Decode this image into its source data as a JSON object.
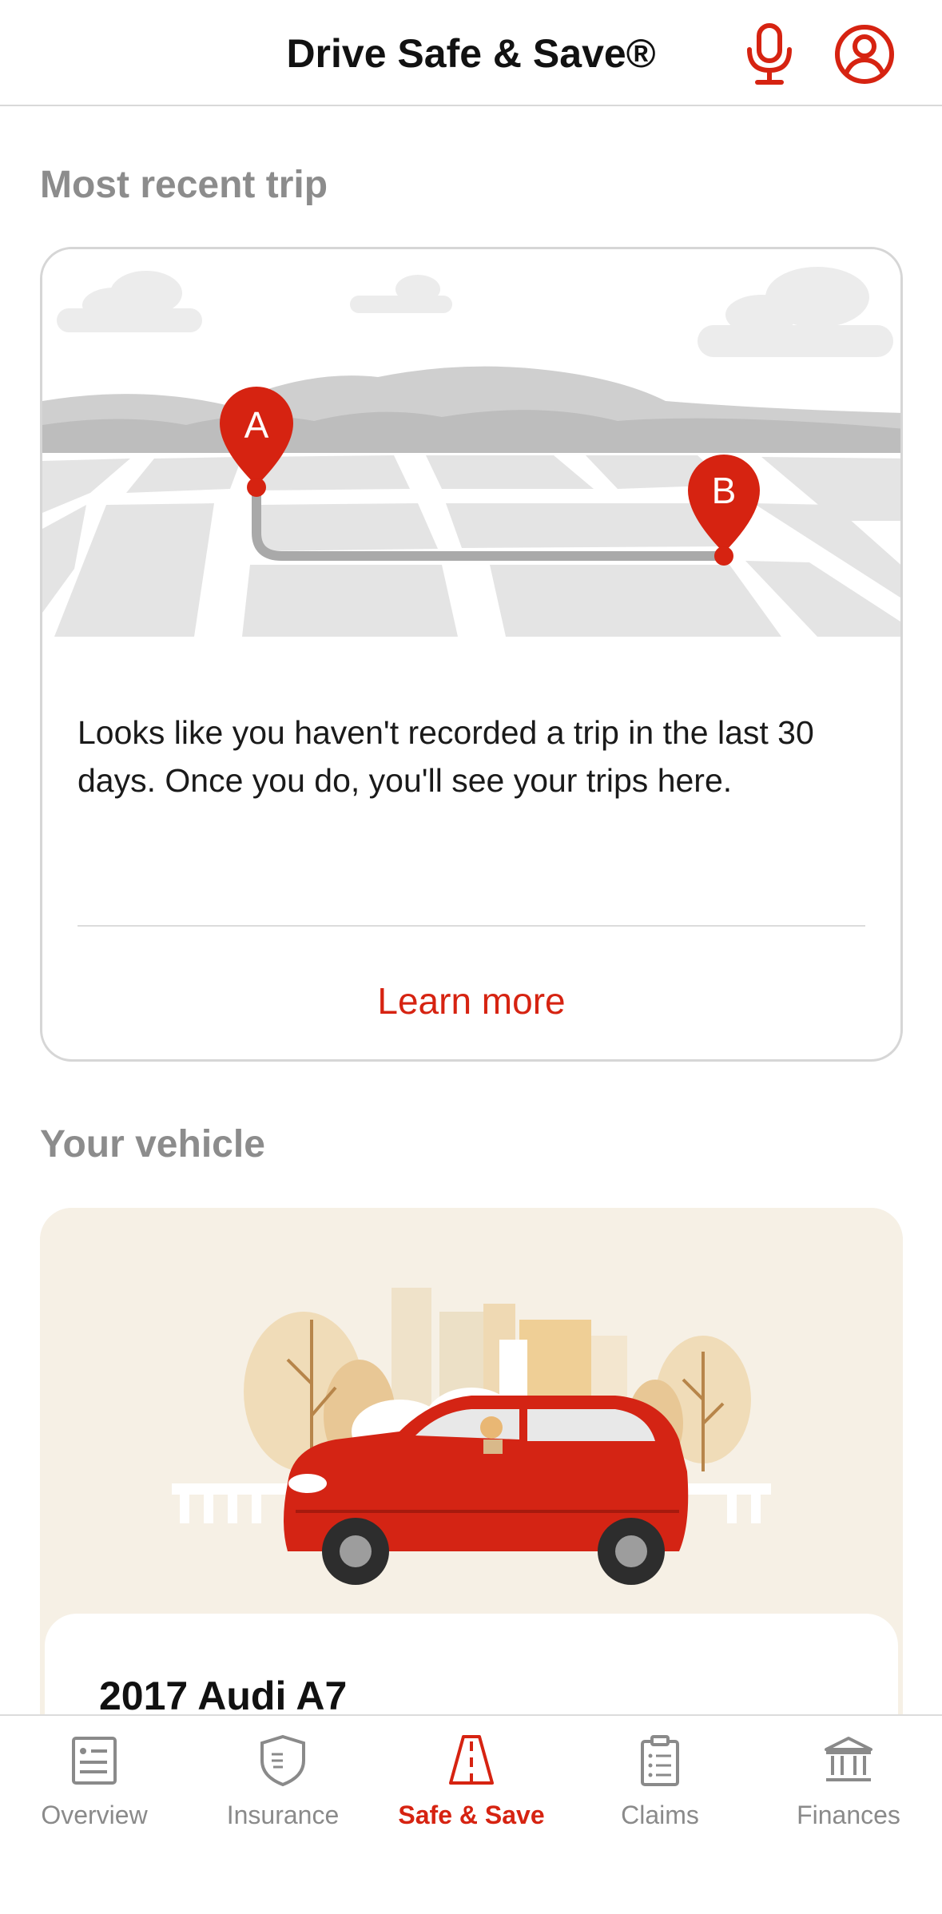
{
  "header": {
    "title": "Drive Safe & Save®"
  },
  "sections": {
    "recent_trip_title": "Most recent trip",
    "vehicle_title": "Your vehicle"
  },
  "trip_card": {
    "marker_a": "A",
    "marker_b": "B",
    "message": "Looks like you haven't recorded a trip in the last 30 days. Once you do, you'll see your trips here.",
    "learn_more": "Learn more"
  },
  "vehicle_card": {
    "name": "2017 Audi A7"
  },
  "tabs": [
    {
      "label": "Overview",
      "icon": "overview-icon"
    },
    {
      "label": "Insurance",
      "icon": "shield-icon"
    },
    {
      "label": "Safe & Save",
      "icon": "road-icon",
      "active": true
    },
    {
      "label": "Claims",
      "icon": "clipboard-icon"
    },
    {
      "label": "Finances",
      "icon": "bank-icon"
    }
  ],
  "colors": {
    "accent": "#d62311",
    "inactive": "#8a8a8a",
    "vehicle_bg": "#f6f0e5"
  }
}
